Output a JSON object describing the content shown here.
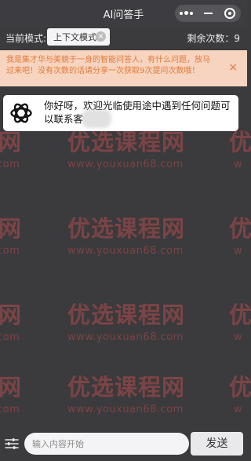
{
  "header": {
    "title": "AI问答手"
  },
  "mode_bar": {
    "mode_label": "当前模式:",
    "mode_value": "上下文模式",
    "remaining_text": "剩余次数：9"
  },
  "notice": {
    "text": "我是集才华与美貌于一身的智能问答人，有什么问题，放马过来吧！没有次数的话请分享一次获取9次提问次数哦！"
  },
  "chat": {
    "messages": [
      {
        "role": "assistant",
        "avatar_icon": "openai-logo-icon",
        "text": "你好呀，欢迎光临使用途中遇到任何问题可以联系客"
      }
    ]
  },
  "watermark": {
    "big": "优选课程网",
    "partial_left": "网",
    "partial_right": "优",
    "url": "www.youxuan68.com",
    "url_partial_left": "com",
    "url_partial_right": "w"
  },
  "composer": {
    "placeholder": "输入内容开始",
    "send_label": "发送"
  },
  "colors": {
    "background": "#3b3a3d",
    "notice_bg": "#f7d4bf",
    "notice_text": "#e07a3b",
    "watermark": "#ff5c5c"
  }
}
